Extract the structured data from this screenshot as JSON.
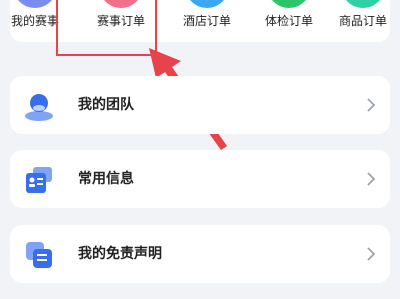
{
  "shortcuts": [
    {
      "label": "我的赛事",
      "color": "#7b8cf0"
    },
    {
      "label": "赛事订单",
      "color": "#f26f8c"
    },
    {
      "label": "酒店订单",
      "color": "#38a8f5"
    },
    {
      "label": "体检订单",
      "color": "#2ec46a"
    },
    {
      "label": "商品订单",
      "color": "#2fd0a6"
    }
  ],
  "highlight": {
    "color": "#e8434b"
  },
  "menu": [
    {
      "label": "我的团队",
      "icon": "team-icon"
    },
    {
      "label": "常用信息",
      "icon": "id-card-icon"
    },
    {
      "label": "我的免责声明",
      "icon": "document-icon"
    }
  ],
  "colors": {
    "accent": "#3a6ee8",
    "chevron": "#a0a4ad"
  }
}
